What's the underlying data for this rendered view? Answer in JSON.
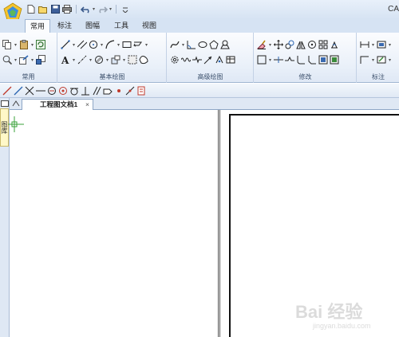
{
  "app": {
    "title_fragment": "CA"
  },
  "quick_access": {
    "items": [
      "new",
      "open",
      "save",
      "print",
      "undo",
      "redo",
      "customize"
    ]
  },
  "ribbon": {
    "tabs": [
      {
        "label": "常用",
        "active": true
      },
      {
        "label": "标注",
        "active": false
      },
      {
        "label": "图幅",
        "active": false
      },
      {
        "label": "工具",
        "active": false
      },
      {
        "label": "视图",
        "active": false
      }
    ],
    "groups": [
      {
        "label": "常用"
      },
      {
        "label": "基本绘图"
      },
      {
        "label": "高级绘图"
      },
      {
        "label": "修改"
      },
      {
        "label": "标注"
      }
    ]
  },
  "document": {
    "tab_label": "工程图文档1",
    "close_symbol": "×"
  },
  "side_panel": {
    "tab_label": "图库"
  },
  "watermark": {
    "text": "Bai 经验",
    "url": "jingyan.baidu.com"
  },
  "colors": {
    "accent": "#2b5797",
    "ribbon_bg": "#e9f0f9",
    "tab_bg": "#d6e3f3"
  }
}
